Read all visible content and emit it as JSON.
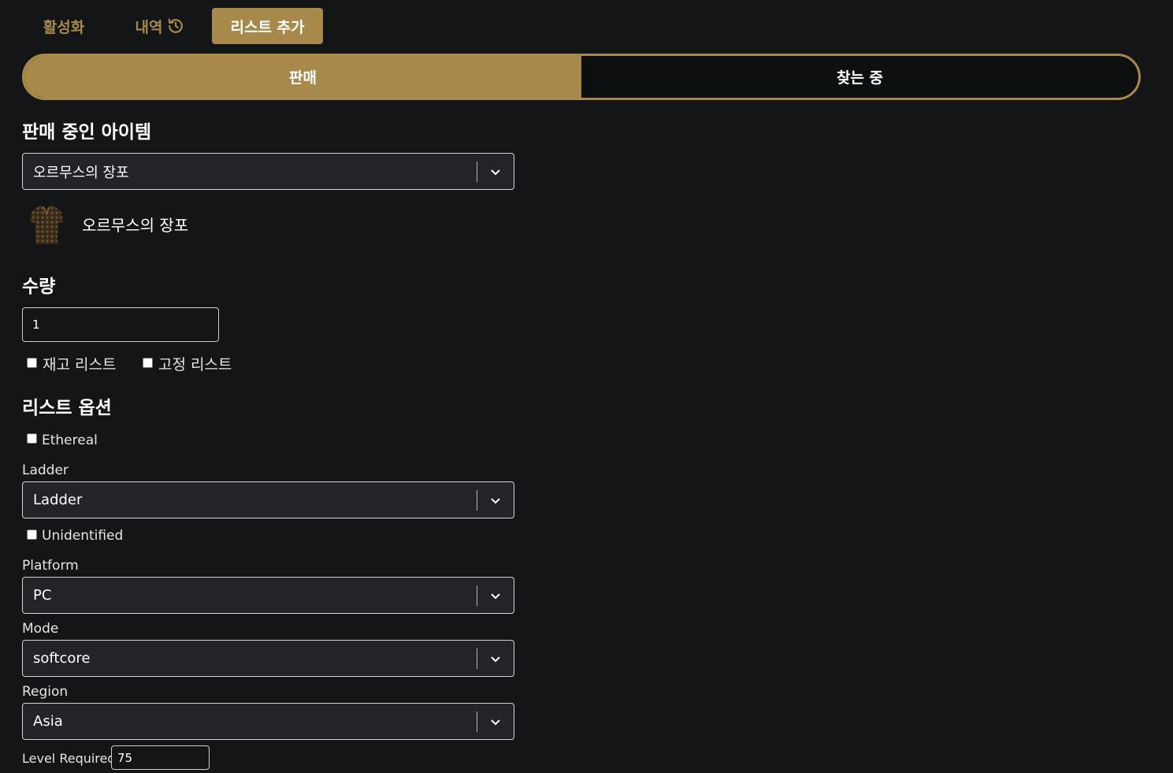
{
  "tabs": [
    {
      "label": "활성화",
      "active": false
    },
    {
      "label": "내역",
      "active": false,
      "icon": "history-icon"
    },
    {
      "label": "리스트 추가",
      "active": true
    }
  ],
  "mode_toggle": {
    "options": [
      "판매",
      "찾는 중"
    ],
    "selected": "판매"
  },
  "item_section": {
    "heading": "판매 중인 아이템",
    "select_value": "오르무스의 장포",
    "preview_name": "오르무스의 장포",
    "preview_icon": "robe-item-icon"
  },
  "quantity": {
    "heading": "수량",
    "value": "1",
    "stock_label": "재고 리스트",
    "fixed_label": "고정 리스트"
  },
  "options": {
    "heading": "리스트 옵션",
    "ethereal_label": "Ethereal",
    "ladder_label": "Ladder",
    "ladder_value": "Ladder",
    "unidentified_label": "Unidentified",
    "platform_label": "Platform",
    "platform_value": "PC",
    "mode_label": "Mode",
    "mode_value": "softcore",
    "region_label": "Region",
    "region_value": "Asia",
    "level_label": "Level Required",
    "level_value": "75"
  },
  "colors": {
    "accent": "#a7894c",
    "background": "#141517",
    "field": "#222427"
  }
}
